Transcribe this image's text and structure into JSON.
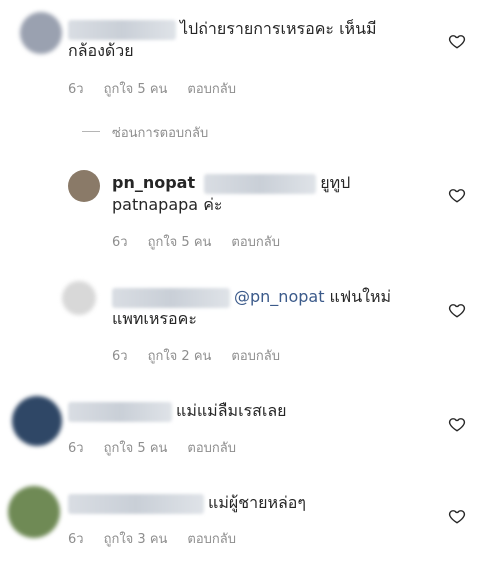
{
  "colors": {
    "text": "#262626",
    "meta": "#8e8e8e",
    "mention": "#3b5a8a",
    "avatar1": "#9aa1b0",
    "avatar2": "#8a7a68",
    "avatar3": "#d8d8d8",
    "avatar4": "#2f4766",
    "avatar5": "#6f8a55"
  },
  "comments": [
    {
      "text_line1": "ไปถ่ายรายการเหรอคะ เห็นมี",
      "text_line2": "กล้องด้วย",
      "time": "6ว",
      "likes": "ถูกใจ 5 คน",
      "reply": "ตอบกลับ",
      "heart_icon": "heart-outline-icon"
    },
    {
      "username": "pn_nopat",
      "text_line1": "ยูทูป",
      "text_line2": "patnapapa ค่ะ",
      "time": "6ว",
      "likes": "ถูกใจ 5 คน",
      "reply": "ตอบกลับ",
      "heart_icon": "heart-outline-icon"
    },
    {
      "mention": "@pn_nopat",
      "text_line1": " แฟนใหม่",
      "text_line2": "แพทเหรอคะ",
      "time": "6ว",
      "likes": "ถูกใจ 2 คน",
      "reply": "ตอบกลับ",
      "heart_icon": "heart-outline-icon"
    },
    {
      "text_line1": "แม่แม่ลืมเรสเลย",
      "time": "6ว",
      "likes": "ถูกใจ 5 คน",
      "reply": "ตอบกลับ",
      "heart_icon": "heart-outline-icon"
    },
    {
      "text_line1": "แม่ผู้ชายหล่อๆ",
      "time": "6ว",
      "likes": "ถูกใจ 3 คน",
      "reply": "ตอบกลับ",
      "heart_icon": "heart-outline-icon"
    }
  ],
  "hide_replies": "ซ่อนการตอบกลับ"
}
